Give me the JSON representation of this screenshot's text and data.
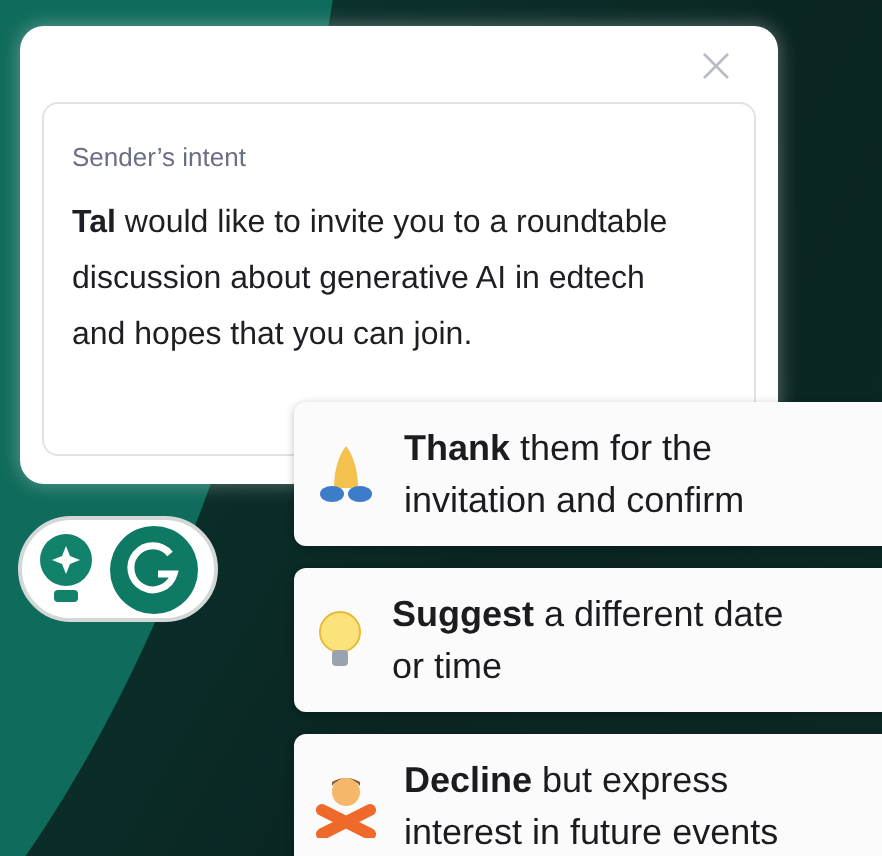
{
  "intent_card": {
    "label": "Sender’s intent",
    "message": "**Tal** would like to invite you to a roundtable discussion about generative AI in edtech and hopes that you can join."
  },
  "suggestions": [
    {
      "kind": "thanks",
      "text": "**Thank** them for the invitation and confirm"
    },
    {
      "kind": "idea",
      "text": "**Suggest** a different date or time"
    },
    {
      "kind": "decline",
      "text": "**Decline** but express interest in future events"
    }
  ]
}
